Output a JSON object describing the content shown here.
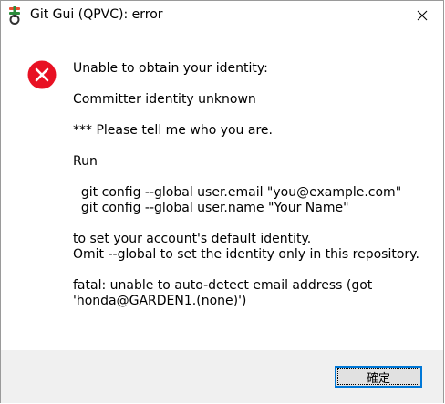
{
  "window": {
    "title": "Git Gui (QPVC): error"
  },
  "dialog": {
    "icon": "error-icon",
    "message": "Unable to obtain your identity:\n\nCommitter identity unknown\n\n*** Please tell me who you are.\n\nRun\n\n  git config --global user.email \"you@example.com\"\n  git config --global user.name \"Your Name\"\n\nto set your account's default identity.\nOmit --global to set the identity only in this repository.\n\nfatal: unable to auto-detect email address (got\n'honda@GARDEN1.(none)')"
  },
  "footer": {
    "ok_label": "確定"
  },
  "colors": {
    "error_red": "#e81123",
    "focus_blue": "#0078d7",
    "footer_bg": "#f0f0f0"
  }
}
